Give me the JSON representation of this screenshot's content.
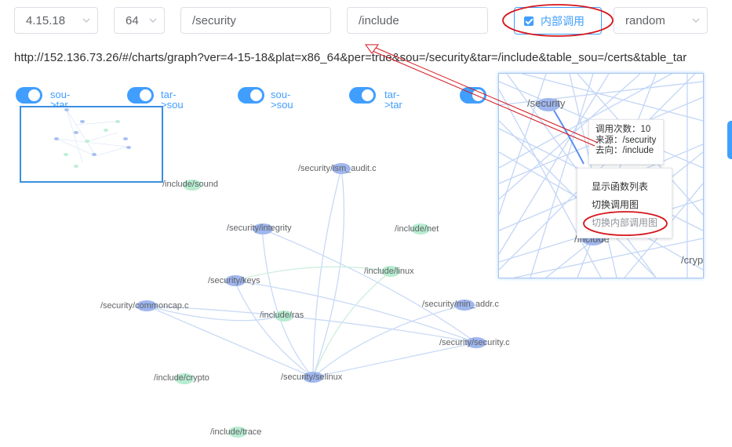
{
  "filters": {
    "version": "4.15.18",
    "platform": "64",
    "source": "/security",
    "target": "/include",
    "internal_call_label": "内部调用",
    "mode": "random"
  },
  "url": "http://152.136.73.26/#/charts/graph?ver=4-15-18&plat=x86_64&per=true&sou=/security&tar=/include&table_sou=/certs&table_tar",
  "toggles": [
    {
      "label1": "sou-",
      "label2": ">tar",
      "on": true
    },
    {
      "label1": "tar-",
      "label2": ">sou",
      "on": true
    },
    {
      "label1": "sou-",
      "label2": ">sou",
      "on": true
    },
    {
      "label1": "tar-",
      "label2": ">tar",
      "on": true
    },
    {
      "on": true
    }
  ],
  "graph": {
    "nodes": [
      {
        "label": "/security/lsm_audit.c",
        "group": "security"
      },
      {
        "label": "/include/sound",
        "group": "include"
      },
      {
        "label": "/security/integrity",
        "group": "security"
      },
      {
        "label": "/include/net",
        "group": "include"
      },
      {
        "label": "/security/keys",
        "group": "security"
      },
      {
        "label": "/include/linux",
        "group": "include"
      },
      {
        "label": "/security/commoncap.c",
        "group": "security"
      },
      {
        "label": "/security/min_addr.c",
        "group": "security"
      },
      {
        "label": "/include/ras",
        "group": "include"
      },
      {
        "label": "/security/security.c",
        "group": "security"
      },
      {
        "label": "/include/crypto",
        "group": "include"
      },
      {
        "label": "/security/selinux",
        "group": "security"
      },
      {
        "label": "/include/trace",
        "group": "include"
      }
    ],
    "colors": {
      "security": "#9fb6ee",
      "include": "#b7ecd0",
      "edge": "#c9daf6"
    }
  },
  "zoom_panel": {
    "labels": {
      "security": "/security",
      "include": "/include",
      "crypto": "/cryp"
    }
  },
  "tooltip": {
    "count_label": "调用次数：",
    "count_value": "10",
    "source_label": "来源：",
    "source_value": "/security",
    "target_label": "去向：",
    "target_value": "/include"
  },
  "context_menu": {
    "items": [
      "显示函数列表",
      "切换调用图",
      "切换内部调用图"
    ]
  },
  "annotation_color": "#d6161c"
}
